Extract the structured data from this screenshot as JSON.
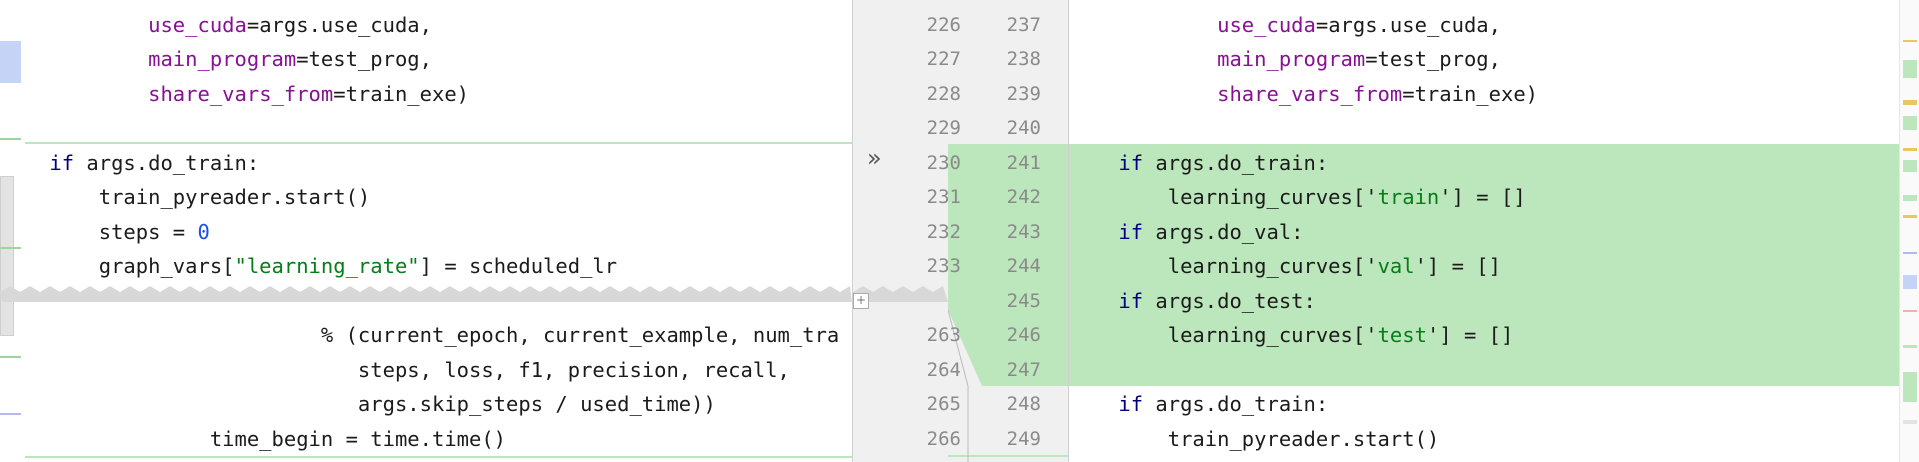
{
  "left": {
    "lines": [
      {
        "tokens": [
          {
            "t": "            "
          },
          {
            "t": "use_cuda",
            "c": "param"
          },
          {
            "t": "=args.use_cuda,"
          }
        ]
      },
      {
        "tokens": [
          {
            "t": "            "
          },
          {
            "t": "main_program",
            "c": "param"
          },
          {
            "t": "=test_prog,"
          }
        ]
      },
      {
        "tokens": [
          {
            "t": "            "
          },
          {
            "t": "share_vars_from",
            "c": "param"
          },
          {
            "t": "=train_exe)"
          }
        ]
      },
      {
        "tokens": [
          {
            "t": ""
          }
        ]
      },
      {
        "tokens": [
          {
            "t": "    "
          },
          {
            "t": "if",
            "c": "kw"
          },
          {
            "t": " args.do_train:"
          }
        ]
      },
      {
        "tokens": [
          {
            "t": "        train_pyreader.start()"
          }
        ]
      },
      {
        "tokens": [
          {
            "t": "        steps = "
          },
          {
            "t": "0",
            "c": "num"
          }
        ]
      },
      {
        "tokens": [
          {
            "t": "        graph_vars["
          },
          {
            "t": "\"learning_rate\"",
            "c": "str"
          },
          {
            "t": "] = scheduled_lr"
          }
        ]
      }
    ],
    "lines_after_fold": [
      {
        "tokens": [
          {
            "t": "                          % (current_epoch, current_example, num_tra"
          }
        ]
      },
      {
        "tokens": [
          {
            "t": "                             steps, loss, f1, precision, recall,"
          }
        ]
      },
      {
        "tokens": [
          {
            "t": "                             args.skip_steps / used_time))"
          }
        ]
      },
      {
        "tokens": [
          {
            "t": "                 time_begin = time.time()"
          }
        ]
      }
    ]
  },
  "gutter": {
    "left_numbers": [
      "226",
      "227",
      "228",
      "229",
      "230",
      "231",
      "232",
      "233",
      "263",
      "264",
      "265",
      "266"
    ],
    "right_numbers": [
      "237",
      "238",
      "239",
      "240",
      "241",
      "242",
      "243",
      "244",
      "245",
      "246",
      "247",
      "248",
      "249"
    ]
  },
  "right": {
    "lines": [
      {
        "tokens": [
          {
            "t": "            "
          },
          {
            "t": "use_cuda",
            "c": "param"
          },
          {
            "t": "=args.use_cuda,"
          }
        ]
      },
      {
        "tokens": [
          {
            "t": "            "
          },
          {
            "t": "main_program",
            "c": "param"
          },
          {
            "t": "=test_prog,"
          }
        ]
      },
      {
        "tokens": [
          {
            "t": "            "
          },
          {
            "t": "share_vars_from",
            "c": "param"
          },
          {
            "t": "=train_exe)"
          }
        ]
      },
      {
        "tokens": [
          {
            "t": ""
          }
        ]
      },
      {
        "tokens": [
          {
            "t": "    "
          },
          {
            "t": "if",
            "c": "kw"
          },
          {
            "t": " args.do_train:"
          }
        ]
      },
      {
        "tokens": [
          {
            "t": "        learning_curves['"
          },
          {
            "t": "train",
            "c": "str"
          },
          {
            "t": "'] = []"
          }
        ]
      },
      {
        "tokens": [
          {
            "t": "    "
          },
          {
            "t": "if",
            "c": "kw"
          },
          {
            "t": " args.do_val:"
          }
        ]
      },
      {
        "tokens": [
          {
            "t": "        learning_curves['"
          },
          {
            "t": "val",
            "c": "str"
          },
          {
            "t": "'] = []"
          }
        ]
      },
      {
        "tokens": [
          {
            "t": "    "
          },
          {
            "t": "if",
            "c": "kw"
          },
          {
            "t": " args.do_test:"
          }
        ]
      },
      {
        "tokens": [
          {
            "t": "        learning_curves['"
          },
          {
            "t": "test",
            "c": "str"
          },
          {
            "t": "'] = []"
          }
        ]
      },
      {
        "tokens": [
          {
            "t": ""
          }
        ]
      },
      {
        "tokens": [
          {
            "t": "    "
          },
          {
            "t": "if",
            "c": "kw"
          },
          {
            "t": " args.do_train:"
          }
        ]
      },
      {
        "tokens": [
          {
            "t": "        train_pyreader.start()"
          }
        ]
      }
    ]
  },
  "icons": {
    "apply_change": "double-chevron-right-icon",
    "expand_fold": "expand-icon"
  },
  "colors": {
    "added": "#bce6bc",
    "keyword": "#000080",
    "parameter": "#871094",
    "string": "#067d17",
    "number": "#1750eb",
    "gutter_bg": "#f0f0f0"
  }
}
